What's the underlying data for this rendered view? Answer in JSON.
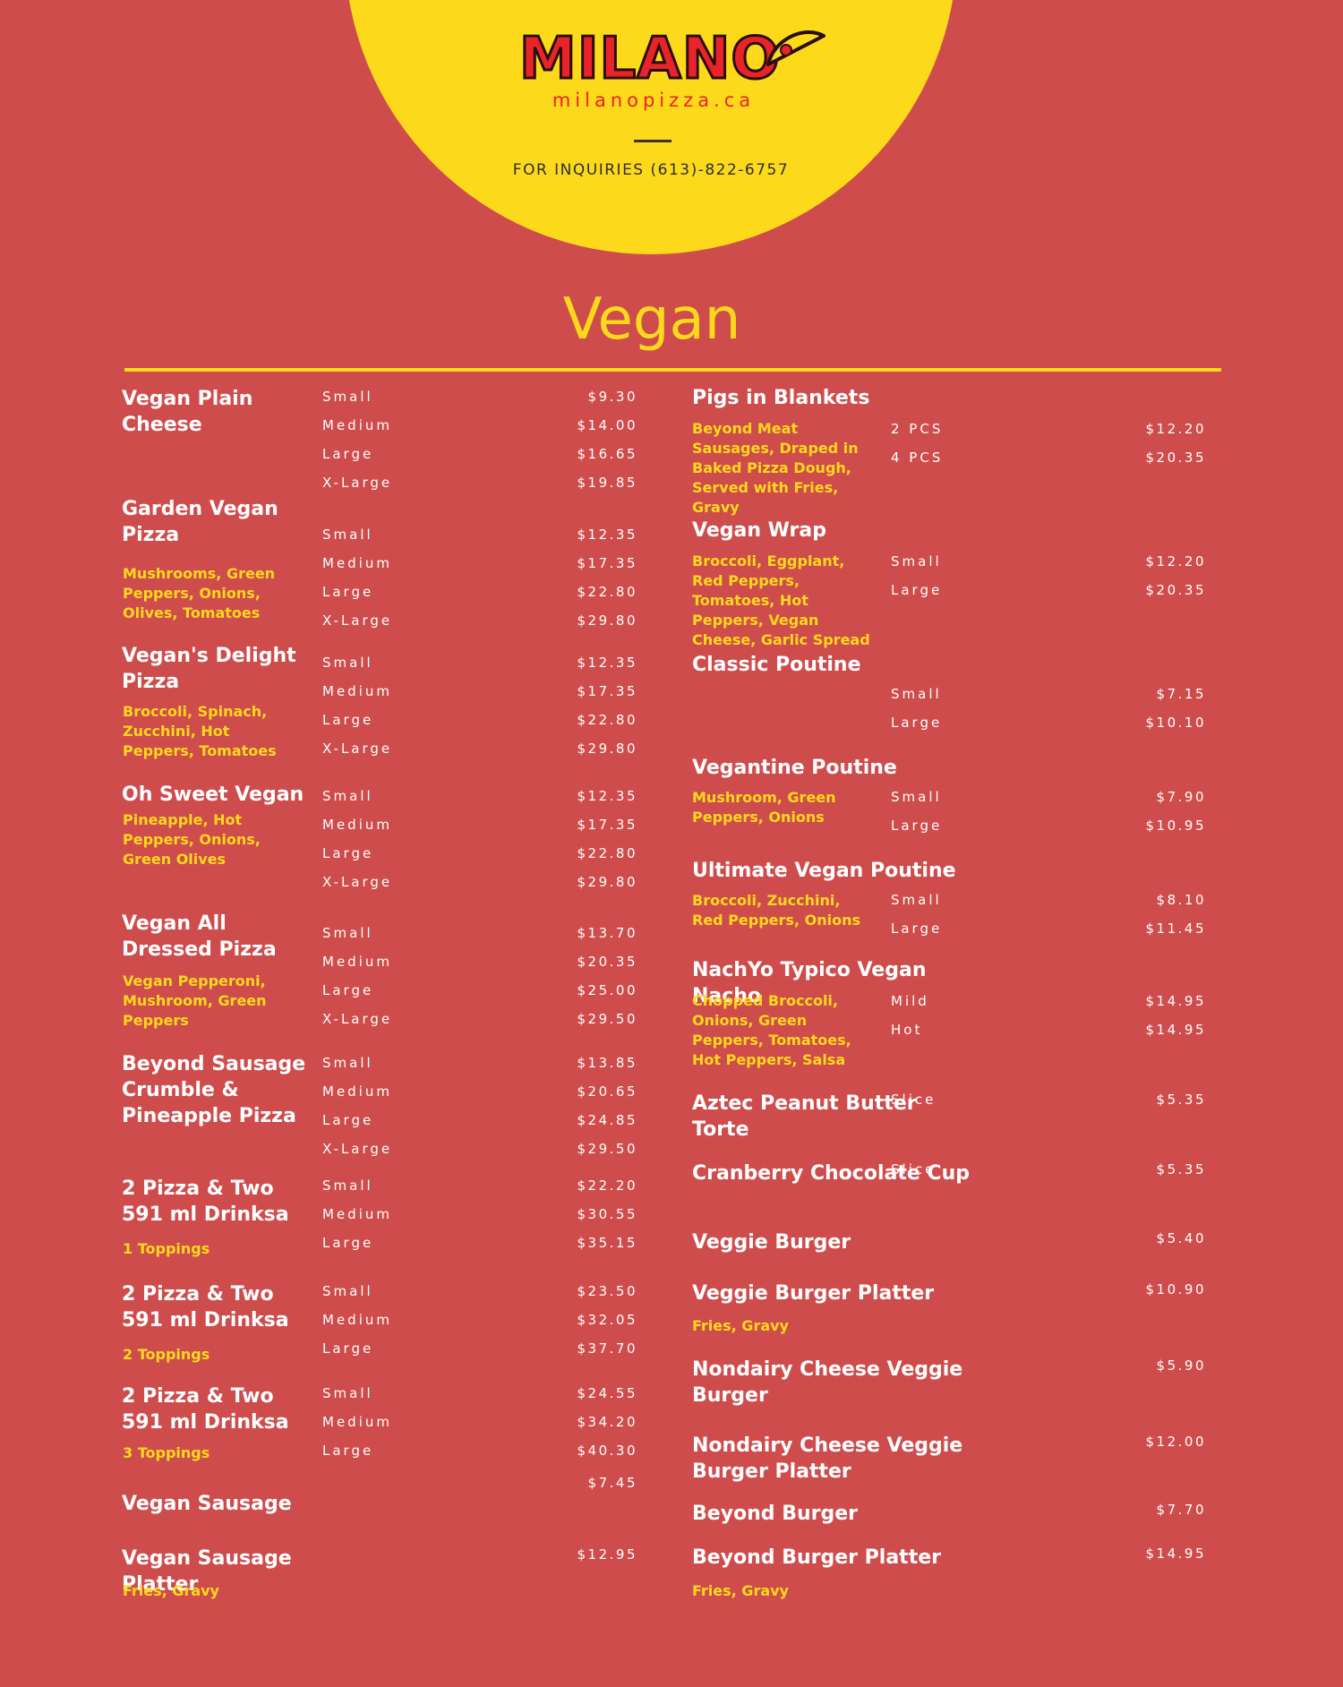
{
  "header": {
    "logo_text": "MILANO",
    "website": "milanopizza.ca",
    "inquiry": "FOR INQUIRIES (613)-822-6757"
  },
  "colors": {
    "background": "#cf4c4c",
    "accent": "#fdd91c",
    "logo_red": "#e8242a"
  },
  "title": "Vegan",
  "left_items": [
    {
      "name": "Vegan Plain Cheese",
      "desc": "",
      "options": [
        {
          "size": "Small",
          "price": "$9.30"
        },
        {
          "size": "Medium",
          "price": "$14.00"
        },
        {
          "size": "Large",
          "price": "$16.65"
        },
        {
          "size": "X-Large",
          "price": "$19.85"
        }
      ]
    },
    {
      "name": "Garden Vegan Pizza",
      "desc": "Mushrooms, Green Peppers, Onions, Olives, Tomatoes",
      "options": [
        {
          "size": "Small",
          "price": "$12.35"
        },
        {
          "size": "Medium",
          "price": "$17.35"
        },
        {
          "size": "Large",
          "price": "$22.80"
        },
        {
          "size": "X-Large",
          "price": "$29.80"
        }
      ]
    },
    {
      "name": "Vegan's Delight Pizza",
      "desc": "Broccoli, Spinach, Zucchini, Hot Peppers, Tomatoes",
      "options": [
        {
          "size": "Small",
          "price": "$12.35"
        },
        {
          "size": "Medium",
          "price": "$17.35"
        },
        {
          "size": "Large",
          "price": "$22.80"
        },
        {
          "size": "X-Large",
          "price": "$29.80"
        }
      ]
    },
    {
      "name": "Oh Sweet Vegan",
      "desc": "Pineapple, Hot Peppers, Onions, Green Olives",
      "options": [
        {
          "size": "Small",
          "price": "$12.35"
        },
        {
          "size": "Medium",
          "price": "$17.35"
        },
        {
          "size": "Large",
          "price": "$22.80"
        },
        {
          "size": "X-Large",
          "price": "$29.80"
        }
      ]
    },
    {
      "name": "Vegan All Dressed Pizza",
      "desc": "Vegan Pepperoni, Mushroom, Green Peppers",
      "options": [
        {
          "size": "Small",
          "price": "$13.70"
        },
        {
          "size": "Medium",
          "price": "$20.35"
        },
        {
          "size": "Large",
          "price": "$25.00"
        },
        {
          "size": "X-Large",
          "price": "$29.50"
        }
      ]
    },
    {
      "name": "Beyond Sausage Crumble & Pineapple Pizza",
      "desc": "",
      "options": [
        {
          "size": "Small",
          "price": "$13.85"
        },
        {
          "size": "Medium",
          "price": "$20.65"
        },
        {
          "size": "Large",
          "price": "$24.85"
        },
        {
          "size": "X-Large",
          "price": "$29.50"
        }
      ]
    },
    {
      "name": "2 Pizza & Two 591 ml Drinksa",
      "desc": "1 Toppings",
      "options": [
        {
          "size": "Small",
          "price": "$22.20"
        },
        {
          "size": "Medium",
          "price": "$30.55"
        },
        {
          "size": "Large",
          "price": "$35.15"
        }
      ]
    },
    {
      "name": "2 Pizza & Two 591 ml Drinksa",
      "desc": "2 Toppings",
      "options": [
        {
          "size": "Small",
          "price": "$23.50"
        },
        {
          "size": "Medium",
          "price": "$32.05"
        },
        {
          "size": "Large",
          "price": "$37.70"
        }
      ]
    },
    {
      "name": "2 Pizza & Two 591 ml Drinksa",
      "desc": "3 Toppings",
      "options": [
        {
          "size": "Small",
          "price": "$24.55"
        },
        {
          "size": "Medium",
          "price": "$34.20"
        },
        {
          "size": "Large",
          "price": "$40.30"
        }
      ]
    },
    {
      "name": "Vegan Sausage",
      "desc": "",
      "options": [
        {
          "size": "",
          "price": "$7.45"
        }
      ]
    },
    {
      "name": "Vegan Sausage Platter",
      "desc": "Fries, Gravy",
      "options": [
        {
          "size": "",
          "price": "$12.95"
        }
      ]
    }
  ],
  "right_items": [
    {
      "name": "Pigs in Blankets",
      "desc": "Beyond Meat Sausages, Draped in Baked Pizza Dough, Served with Fries, Gravy",
      "options": [
        {
          "size": "2 PCS",
          "price": "$12.20"
        },
        {
          "size": "4 PCS",
          "price": "$20.35"
        }
      ]
    },
    {
      "name": "Vegan Wrap",
      "desc": "Broccoli, Eggplant, Red Peppers, Tomatoes, Hot Peppers, Vegan Cheese, Garlic Spread",
      "options": [
        {
          "size": "Small",
          "price": "$12.20"
        },
        {
          "size": "Large",
          "price": "$20.35"
        }
      ]
    },
    {
      "name": "Classic Poutine",
      "desc": "",
      "options": [
        {
          "size": "Small",
          "price": "$7.15"
        },
        {
          "size": "Large",
          "price": "$10.10"
        }
      ]
    },
    {
      "name": "Vegantine Poutine",
      "desc": "Mushroom, Green Peppers, Onions",
      "options": [
        {
          "size": "Small",
          "price": "$7.90"
        },
        {
          "size": "Large",
          "price": "$10.95"
        }
      ]
    },
    {
      "name": "Ultimate Vegan Poutine",
      "desc": "Broccoli, Zucchini, Red Peppers, Onions",
      "options": [
        {
          "size": "Small",
          "price": "$8.10"
        },
        {
          "size": "Large",
          "price": "$11.45"
        }
      ]
    },
    {
      "name": "NachYo Typico Vegan Nacho",
      "desc": "Chopped Broccoli, Onions, Green Peppers, Tomatoes, Hot Peppers, Salsa",
      "options": [
        {
          "size": "Mild",
          "price": "$14.95"
        },
        {
          "size": "Hot",
          "price": "$14.95"
        }
      ]
    },
    {
      "name": "Aztec Peanut Butter Torte",
      "desc": "",
      "options": [
        {
          "size": "Slice",
          "price": "$5.35"
        }
      ]
    },
    {
      "name": "Cranberry Chocolate Cup",
      "desc": "",
      "options": [
        {
          "size": "Slice",
          "price": "$5.35"
        }
      ]
    },
    {
      "name": "Veggie Burger",
      "desc": "",
      "options": [
        {
          "size": "",
          "price": "$5.40"
        }
      ]
    },
    {
      "name": "Veggie Burger Platter",
      "desc": "Fries, Gravy",
      "options": [
        {
          "size": "",
          "price": "$10.90"
        }
      ]
    },
    {
      "name": "Nondairy Cheese Veggie Burger",
      "desc": "",
      "options": [
        {
          "size": "",
          "price": "$5.90"
        }
      ]
    },
    {
      "name": "Nondairy Cheese Veggie Burger Platter",
      "desc": "",
      "options": [
        {
          "size": "",
          "price": "$12.00"
        }
      ]
    },
    {
      "name": "Beyond Burger",
      "desc": "",
      "options": [
        {
          "size": "",
          "price": "$7.70"
        }
      ]
    },
    {
      "name": "Beyond Burger Platter",
      "desc": "Fries, Gravy",
      "options": [
        {
          "size": "",
          "price": "$14.95"
        }
      ]
    }
  ]
}
